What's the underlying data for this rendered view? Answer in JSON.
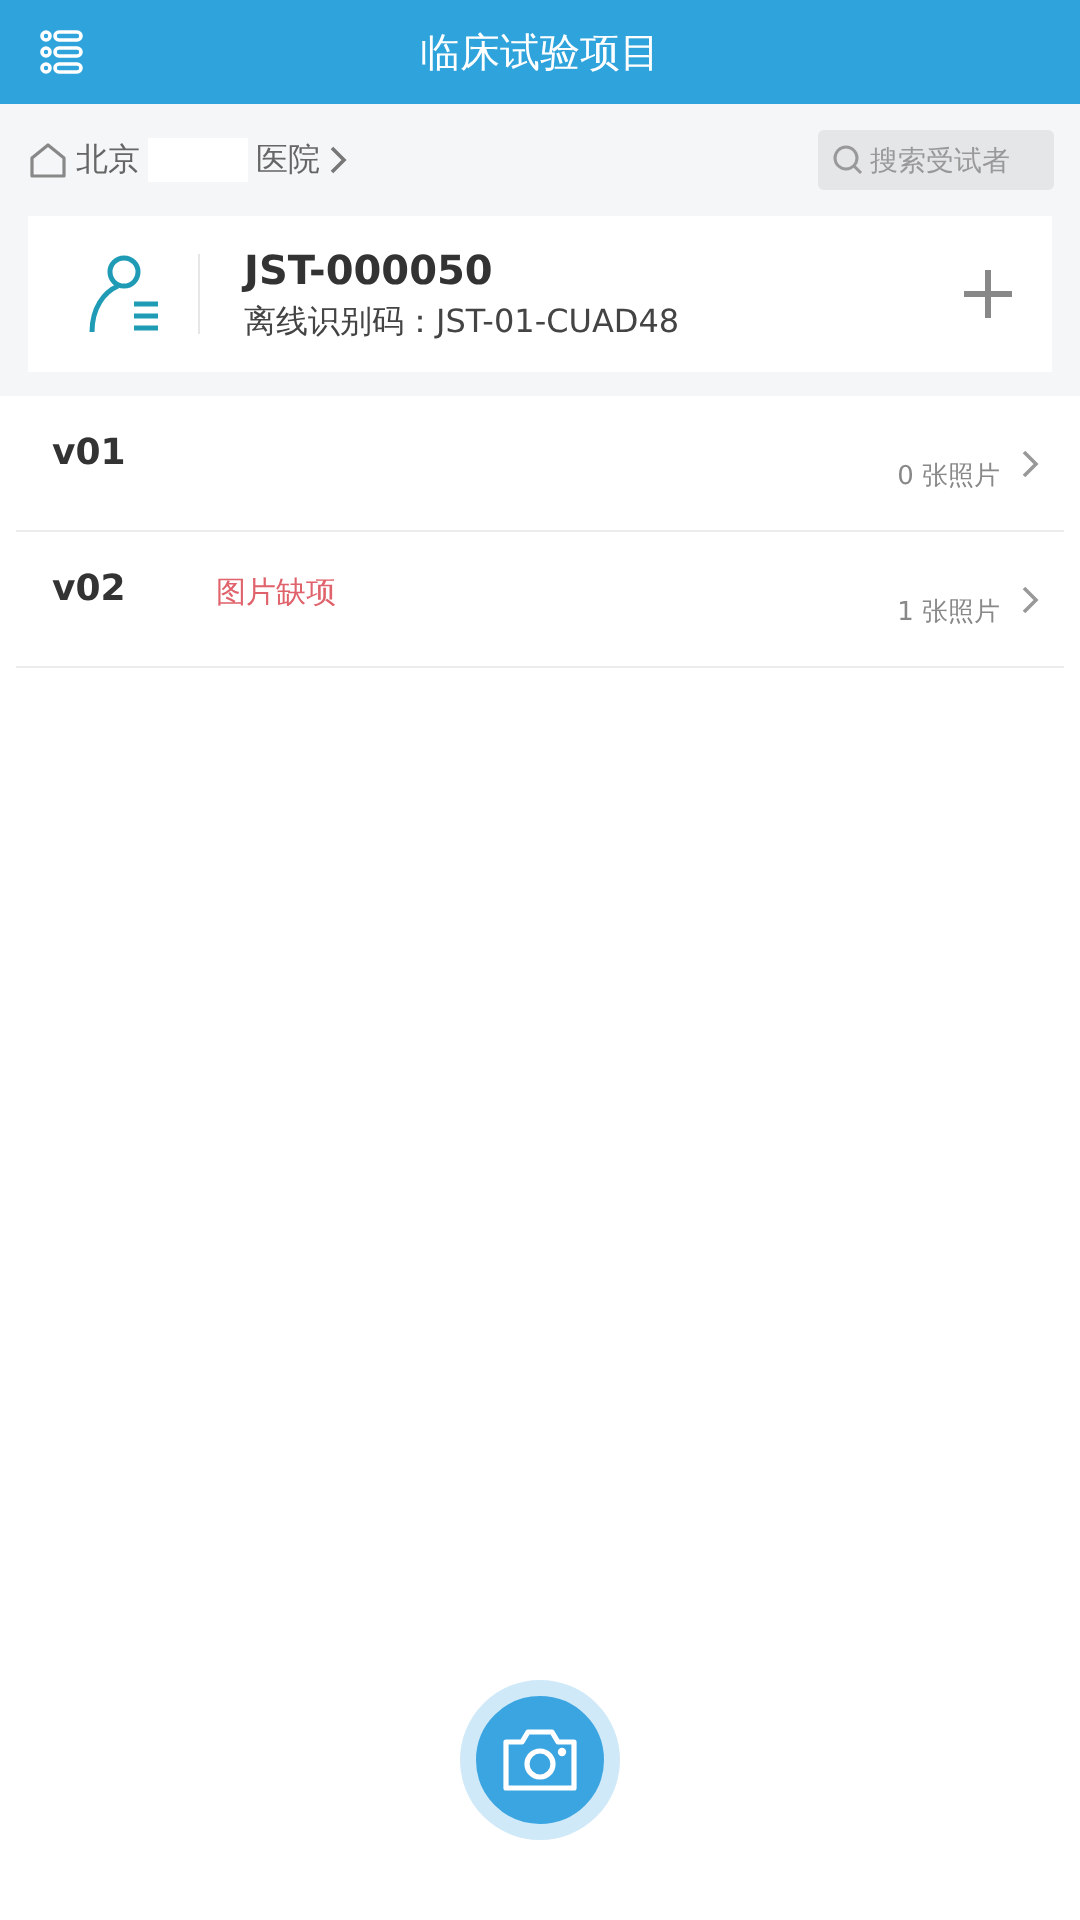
{
  "header": {
    "title": "临床试验项目"
  },
  "breadcrumb": {
    "parts": [
      "北京",
      "医院"
    ],
    "redacted": true
  },
  "search": {
    "placeholder": "搜索受试者"
  },
  "subject": {
    "id": "JST-000050",
    "offline_code": "离线识别码：JST-01-CUAD48"
  },
  "visits": [
    {
      "name": "v01",
      "photos": "0 张照片"
    },
    {
      "name": "v02",
      "flag": "图片缺项",
      "photos": "1 张照片"
    }
  ]
}
